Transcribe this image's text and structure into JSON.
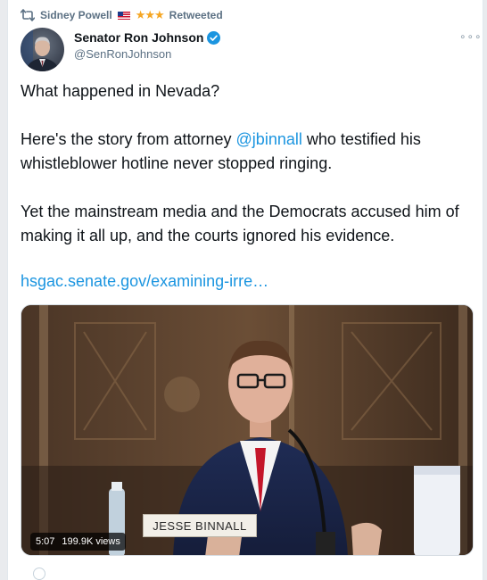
{
  "retweet": {
    "retweeter": "Sidney Powell",
    "flag_icon": "us-flag-icon",
    "stars": "★★★",
    "label": "Retweeted"
  },
  "author": {
    "name": "Senator Ron Johnson",
    "handle": "@SenRonJohnson",
    "verified": true
  },
  "tweet": {
    "line1": "What happened in Nevada?",
    "para2_before": "Here's the story from attorney ",
    "mention": "@jbinnall",
    "para2_after": " who testified his whistleblower hotline never stopped ringing.",
    "para3": "Yet the mainstream media and the Democrats accused him of making it all up, and the courts ignored his evidence.",
    "link": "hsgac.senate.gov/examining-irre…"
  },
  "video": {
    "nameplate": "JESSE BINNALL",
    "duration": "5:07",
    "views": "199.9K views"
  },
  "colors": {
    "accent": "#1b95e0",
    "muted": "#5b7083",
    "stars": "#f5a623"
  }
}
